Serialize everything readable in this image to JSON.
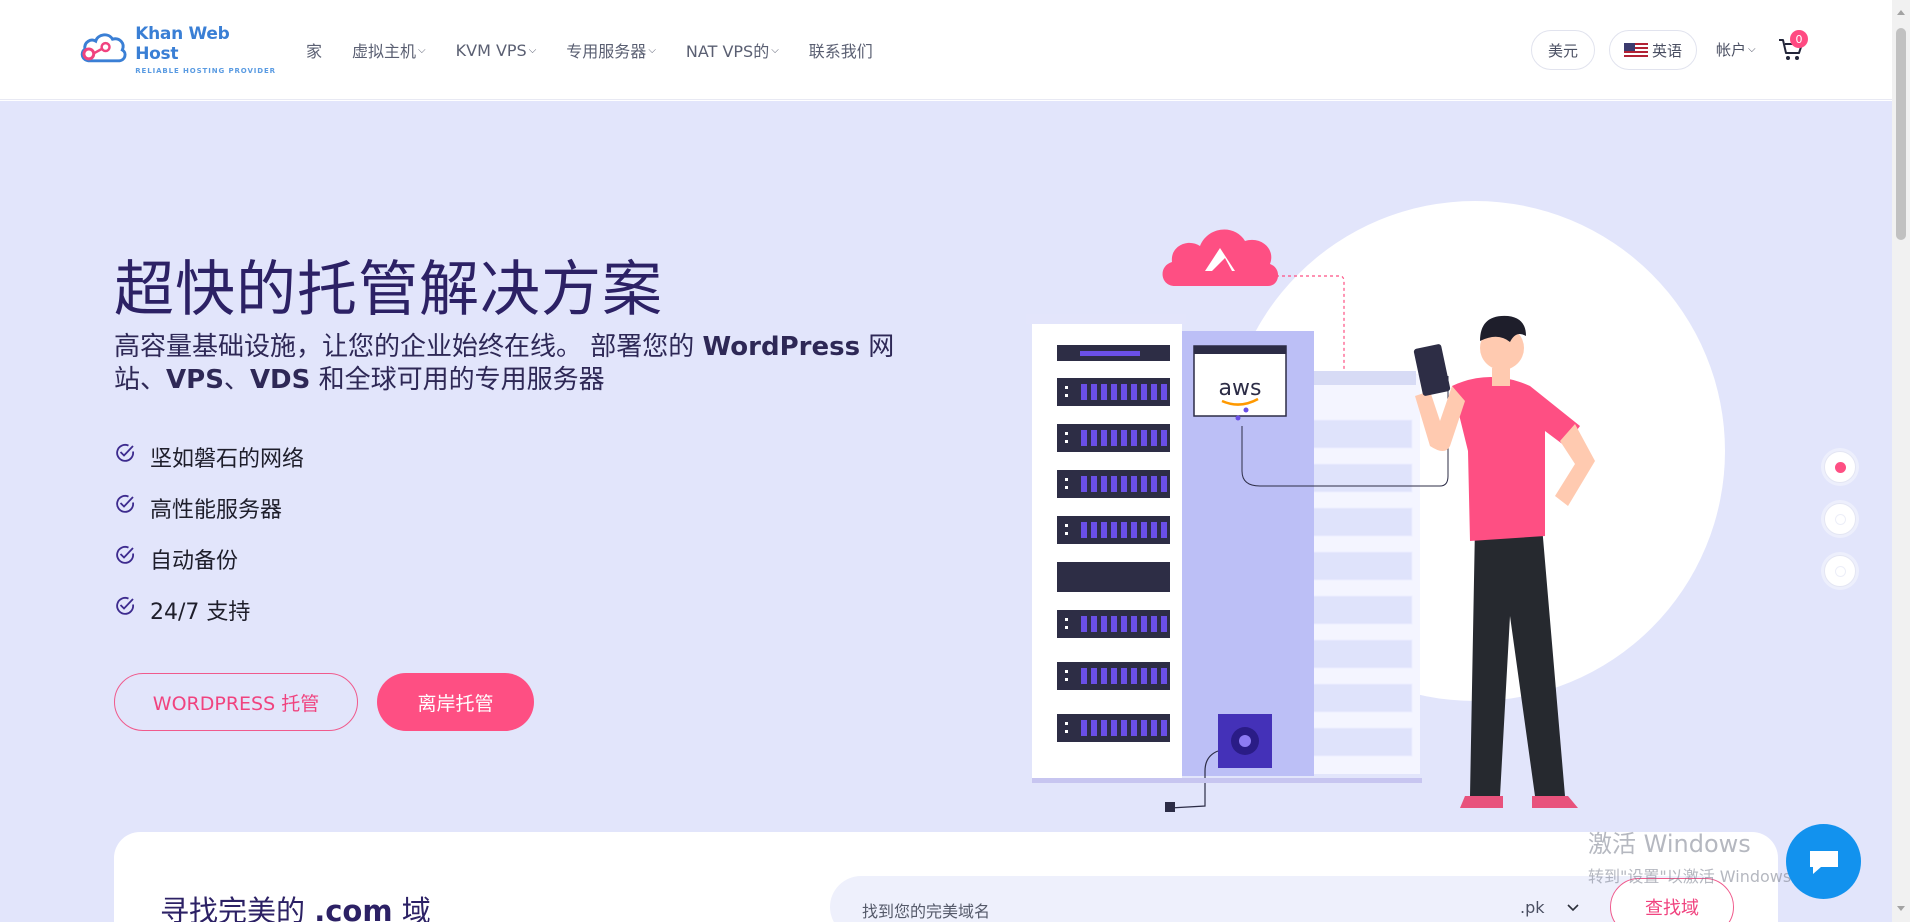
{
  "brand": {
    "name": "Khan Web Host",
    "tagline": "RELIABLE HOSTING PROVIDER",
    "color": "#3a7fd5"
  },
  "nav": {
    "home": "家",
    "shared": "虚拟主机",
    "kvm": "KVM VPS",
    "dedicated": "专用服务器",
    "nat": "NAT VPS的",
    "contact": "联系我们"
  },
  "header": {
    "currency": "美元",
    "language": "英语",
    "account": "帐户",
    "cart_count": "0"
  },
  "hero": {
    "title": "超快的托管解决方案",
    "subtitle_part1": "高容量基础设施，让您的企业始终在线。 部署您的 ",
    "subtitle_bold1": "WordPress",
    "subtitle_part2": " 网站、",
    "subtitle_bold2": "VPS",
    "subtitle_part3": "、",
    "subtitle_bold3": "VDS",
    "subtitle_part4": " 和全球可用的专用服务器",
    "features": [
      "坚如磐石的网络",
      "高性能服务器",
      "自动备份",
      "24/7 支持"
    ],
    "btn_outline": "WORDPRESS 托管",
    "btn_solid": "离岸托管",
    "illustration_logo": "aws",
    "slider_active": 1,
    "slider_count": 3
  },
  "domain": {
    "title_prefix": "寻找完美的 ",
    "title_bold": ".com",
    "title_suffix": " 域",
    "placeholder": "找到您的完美域名",
    "tld": ".pk",
    "button": "查找域"
  },
  "watermark": {
    "line1": "激活 Windows",
    "line2": "转到\"设置\"以激活 Windows。"
  },
  "colors": {
    "accent": "#fe4f83",
    "hero_bg": "#e2e5fb",
    "title": "#2c2165",
    "server_purple": "#6a4fe6",
    "chat": "#1292ee"
  },
  "icons": {
    "cart": "cart-icon",
    "check": "check-circle-icon",
    "chat": "chat-bubble-icon",
    "chevron": "chevron-down-icon"
  }
}
